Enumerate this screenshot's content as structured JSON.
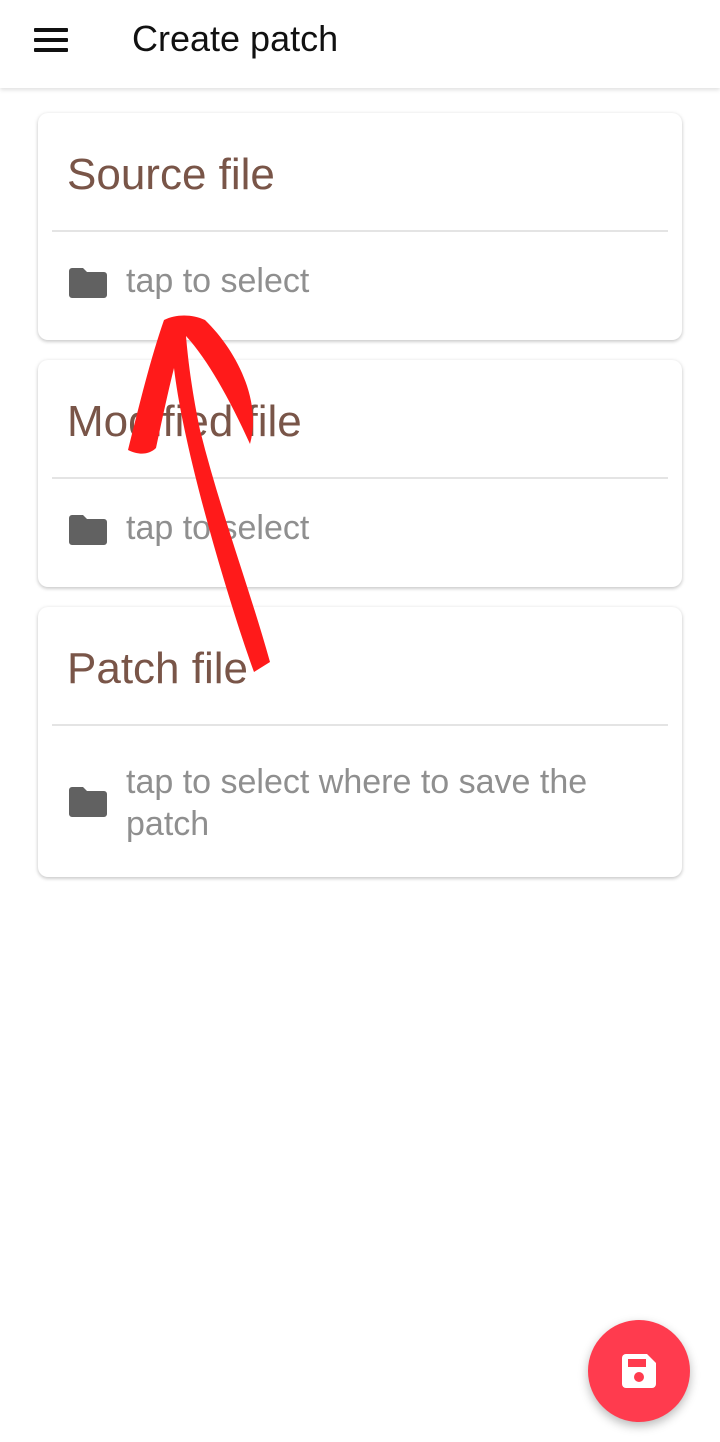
{
  "appbar": {
    "title": "Create patch",
    "menu_icon": "hamburger-menu-icon"
  },
  "cards": [
    {
      "title": "Source file",
      "row_text": "tap to select",
      "icon": "folder-icon"
    },
    {
      "title": "Modified file",
      "row_text": "tap to select",
      "icon": "folder-icon"
    },
    {
      "title": "Patch file",
      "row_text": "tap to select where to save the patch",
      "icon": "folder-icon"
    }
  ],
  "fab": {
    "icon": "save-icon",
    "color": "#ff3b4e"
  },
  "colors": {
    "card_title": "#795548",
    "row_text": "#8f8f8f",
    "icon": "#616161",
    "annotation_arrow": "#ff1a1a"
  }
}
